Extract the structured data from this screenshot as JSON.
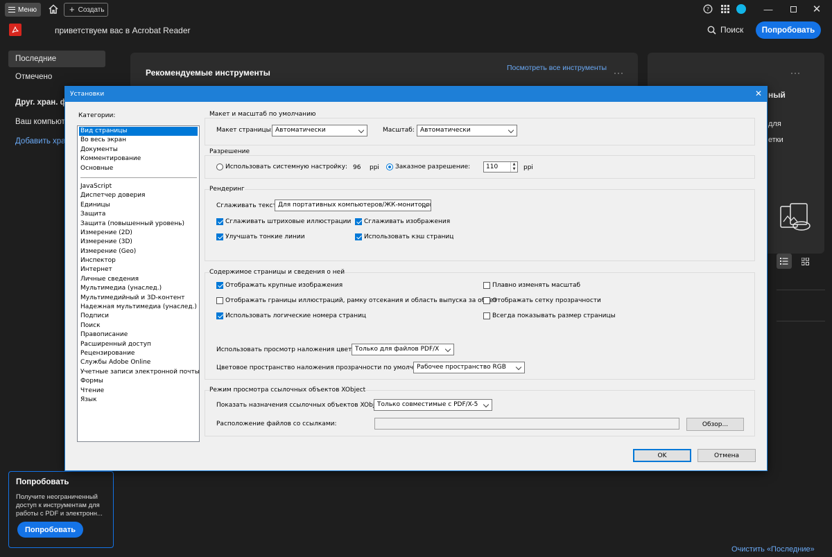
{
  "titlebar": {
    "menu_label": "Меню",
    "create_label": "Создать"
  },
  "header": {
    "welcome": "приветствуем вас в Acrobat Reader",
    "search_label": "Поиск",
    "try_label": "Попробовать"
  },
  "nav": {
    "items": [
      "Последние",
      "Отмечено"
    ],
    "other_storage": "Друг. хран. фа",
    "computer": "Ваш компьюте",
    "add_storage": "Добавить хран"
  },
  "promo": {
    "title": "Попробовать",
    "text": "Получите неограниченный доступ к инструментам для работы с PDF и электронн...",
    "button": "Попробовать"
  },
  "main": {
    "recommended_title": "Рекомендуемые инструменты",
    "see_all": "Посмотреть все инструменты",
    "right_frag1": "ный",
    "right_frag2": "для",
    "right_frag3": "етки",
    "clear_recent": "Очистить «Последние»"
  },
  "dialog": {
    "title": "Установки",
    "categories_label": "Категории:",
    "categories_top": [
      "Вид страницы",
      "Во весь экран",
      "Документы",
      "Комментирование",
      "Основные"
    ],
    "categories_bottom": [
      "JavaScript",
      "Диспетчер доверия",
      "Единицы",
      "Защита",
      "Защита (повышенный уровень)",
      "Измерение (2D)",
      "Измерение (3D)",
      "Измерение (Geo)",
      "Инспектор",
      "Интернет",
      "Личные сведения",
      "Мультимедиа (унаслед.)",
      "Мультимедийный и 3D-контент",
      "Надежная мультимедиа (унаслед.)",
      "Подписи",
      "Поиск",
      "Правописание",
      "Расширенный доступ",
      "Рецензирование",
      "Службы Adobe Online",
      "Учетные записи электронной почты",
      "Формы",
      "Чтение",
      "Язык"
    ],
    "layout": {
      "title": "Макет и масштаб по умолчанию",
      "page_layout_label": "Макет страницы:",
      "page_layout_value": "Автоматически",
      "zoom_label": "Масштаб:",
      "zoom_value": "Автоматически"
    },
    "resolution": {
      "title": "Разрешение",
      "system_label": "Использовать системную настройку:",
      "system_value": "96",
      "unit": "ppi",
      "custom_label": "Заказное разрешение:",
      "custom_value": "110",
      "unit2": "ppi"
    },
    "rendering": {
      "title": "Рендеринг",
      "smooth_text_label": "Сглаживать текст:",
      "smooth_text_value": "Для портативных компьютеров/ЖК-мониторов",
      "smooth_line_art": "Сглаживать штриховые иллюстрации",
      "smooth_images": "Сглаживать изображения",
      "enhance_thin": "Улучшать тонкие линии",
      "page_cache": "Использовать кэш страниц"
    },
    "content": {
      "title": "Содержимое страницы и сведения о ней",
      "show_large_images": "Отображать крупные изображения",
      "smooth_zoom": "Плавно изменять масштаб",
      "show_art_boxes": "Отображать границы иллюстраций, рамку отсекания и область выпуска за обрез",
      "show_transparency_grid": "Отображать сетку прозрачности",
      "logical_page_numbers": "Использовать логические номера страниц",
      "always_show_page_size": "Всегда показывать размер страницы",
      "overprint_label": "Использовать просмотр наложения цветов:",
      "overprint_value": "Только для файлов PDF/X",
      "blend_label": "Цветовое пространство наложения прозрачности по умолчанию:",
      "blend_value": "Рабочее пространство RGB"
    },
    "xobject": {
      "title": "Режим просмотра ссылочных объектов XObject",
      "show_targets_label": "Показать назначения ссылочных объектов XObject:",
      "show_targets_value": "Только совместимые с PDF/X-5",
      "location_label": "Расположение файлов со ссылками:",
      "browse": "Обзор..."
    },
    "ok": "OK",
    "cancel": "Отмена"
  },
  "colors": {
    "accent": "#1473e6",
    "dialog_title": "#1e7fd7",
    "adobe_red": "#d7261e"
  }
}
